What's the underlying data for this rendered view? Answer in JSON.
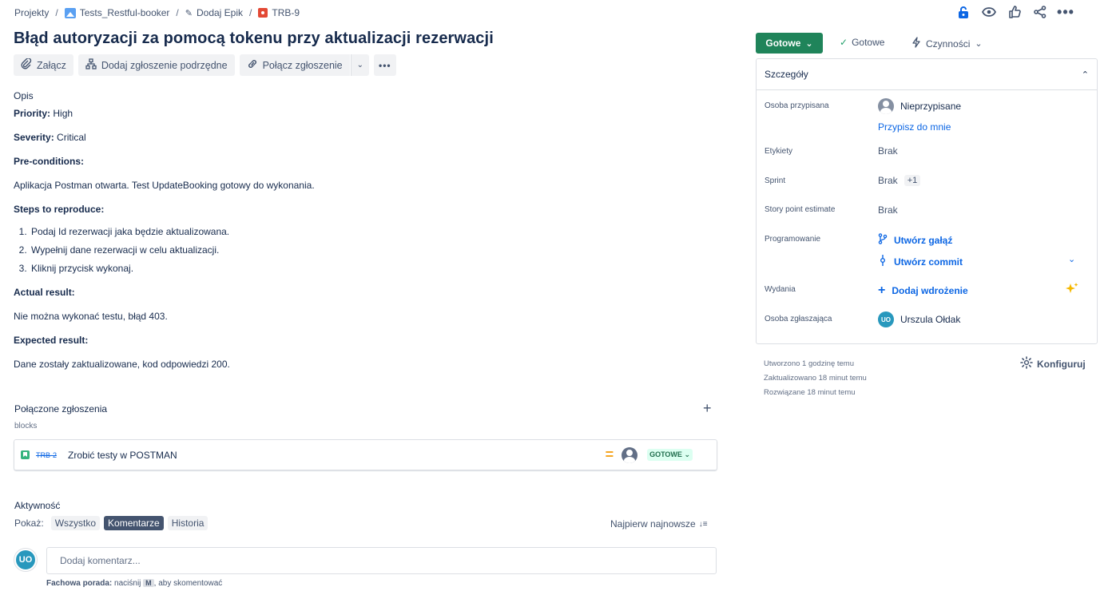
{
  "breadcrumb": {
    "items": [
      "Projekty",
      "Tests_Restful-booker",
      "Dodaj Epik",
      "TRB-9"
    ]
  },
  "top_icons": [
    "lock-icon",
    "eye-icon",
    "thumbs-up-icon",
    "share-icon",
    "more-icon"
  ],
  "issue": {
    "title": "Błąd autoryzacji za pomocą tokenu przy aktualizacji rezerwacji"
  },
  "toolbar": {
    "attach": "Załącz",
    "add_child": "Dodaj zgłoszenie podrzędne",
    "link_issue": "Połącz zgłoszenie"
  },
  "description": {
    "label": "Opis",
    "priority_label": "Priority:",
    "priority_value": "High",
    "severity_label": "Severity:",
    "severity_value": "Critical",
    "preconditions_label": "Pre-conditions:",
    "preconditions_text": "Aplikacja Postman otwarta. Test UpdateBooking gotowy do wykonania.",
    "steps_label": "Steps to reproduce:",
    "steps": [
      "Podaj Id rezerwacji jaka będzie aktualizowana.",
      "Wypełnij dane rezerwacji w celu aktualizacji.",
      "Kliknij przycisk wykonaj."
    ],
    "actual_label": "Actual result:",
    "actual_text": "Nie można wykonać testu, błąd 403.",
    "expected_label": "Expected result:",
    "expected_text": "Dane zostały zaktualizowane, kod odpowiedzi 200."
  },
  "linked": {
    "heading": "Połączone zgłoszenia",
    "type": "blocks",
    "item": {
      "key": "TRB-2",
      "summary": "Zrobić testy w POSTMAN",
      "status": "GOTOWE"
    }
  },
  "activity": {
    "heading": "Aktywność",
    "show_label": "Pokaż:",
    "filters": [
      "Wszystko",
      "Komentarze",
      "Historia"
    ],
    "active_filter": "Komentarze",
    "sort": "Najpierw najnowsze",
    "avatar": "UO",
    "comment_placeholder": "Dodaj komentarz...",
    "tip_prefix": "Fachowa porada:",
    "tip_mid": "naciśnij",
    "tip_key": "M",
    "tip_suffix": ", aby skomentować"
  },
  "status": {
    "button": "Gotowe",
    "resolution": "Gotowe",
    "actions": "Czynności",
    "button_color": "#1f845a"
  },
  "details": {
    "heading": "Szczegóły",
    "assignee_label": "Osoba przypisana",
    "assignee_value": "Nieprzypisane",
    "assign_to_me": "Przypisz do mnie",
    "labels_label": "Etykiety",
    "labels_value": "Brak",
    "sprint_label": "Sprint",
    "sprint_value": "Brak",
    "sprint_extra": "+1",
    "story_points_label": "Story point estimate",
    "story_points_value": "Brak",
    "dev_label": "Programowanie",
    "create_branch": "Utwórz gałąź",
    "create_commit": "Utwórz commit",
    "releases_label": "Wydania",
    "add_deployment": "Dodaj wdrożenie",
    "reporter_label": "Osoba zgłaszająca",
    "reporter_avatar": "UO",
    "reporter_value": "Urszula Ołdak"
  },
  "meta": {
    "created": "Utworzono 1 godzinę temu",
    "updated": "Zaktualizowano 18 minut temu",
    "resolved": "Rozwiązane 18 minut temu",
    "configure": "Konfiguruj"
  }
}
